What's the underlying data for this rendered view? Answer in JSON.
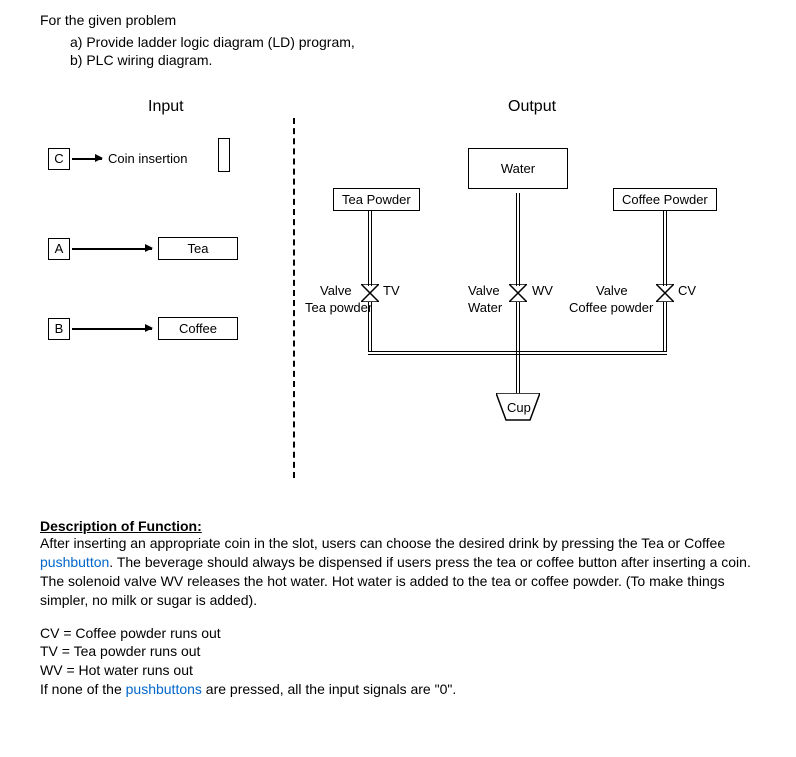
{
  "prompt": {
    "intro": "For the given problem",
    "a": "a)   Provide ladder logic diagram (LD) program,",
    "b": "b)   PLC wiring diagram."
  },
  "headers": {
    "input": "Input",
    "output": "Output"
  },
  "inputs": {
    "c": "C",
    "a": "A",
    "b": "B",
    "coin_label": "Coin insertion",
    "tea_label": "Tea",
    "coffee_label": "Coffee"
  },
  "output_boxes": {
    "tea_powder": "Tea Powder",
    "water": "Water",
    "coffee_powder": "Coffee Powder",
    "cup": "Cup"
  },
  "valves": {
    "tv_label1": "Valve",
    "tv_label2": "Tea powder",
    "tv_code": "TV",
    "wv_label1": "Valve",
    "wv_label2": "Water",
    "wv_code": "WV",
    "cv_label1": "Valve",
    "cv_label2": "Coffee powder",
    "cv_code": "CV"
  },
  "description": {
    "heading": "Description of Function:",
    "para_before_link1": "After inserting an appropriate coin in the slot, users can choose the desired drink by pressing the Tea or Coffee ",
    "link1": "pushbutton",
    "para_after_link1": ". The beverage should always be dispensed if users press the tea or coffee button after inserting a coin. The solenoid valve WV releases the hot water. Hot water is added to the tea or coffee powder. (To make things simpler, no milk or sugar is added).",
    "cv": "CV = Coffee powder runs out",
    "tv": "TV = Tea powder runs out",
    "wv": "WV = Hot water runs out",
    "last_before_link": "If none of the ",
    "link2": "pushbuttons",
    "last_after_link": " are pressed, all the input signals are \"0\"."
  }
}
